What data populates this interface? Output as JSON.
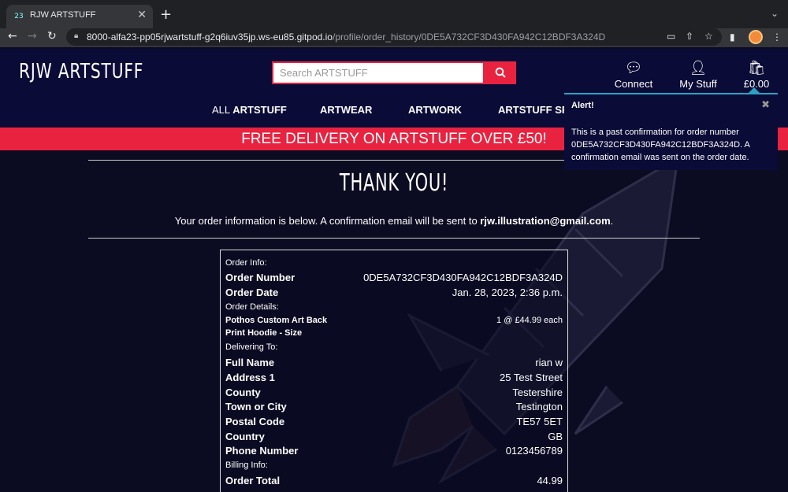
{
  "browser": {
    "tab_title": "RJW ARTSTUFF",
    "tab_favicon": "23",
    "url_host": "8000-alfa23-pp05rjwartstuff-g2q6iuv35jp.ws-eu85.gitpod.io",
    "url_path": "/profile/order_history/0DE5A732CF3D430FA942C12BDF3A324D",
    "icons": [
      "back-icon",
      "forward-icon",
      "reload-icon",
      "lock-icon",
      "card-icon",
      "share-icon",
      "star-icon",
      "sidebar-icon",
      "profile-avatar",
      "menu-icon"
    ]
  },
  "header": {
    "logo": "RJW ARTSTUFF",
    "search_placeholder": "Search ARTSTUFF",
    "connect_label": "Connect",
    "mystuff_label": "My Stuff",
    "bag_total": "£0.00",
    "nav": {
      "all_prefix": "ALL ",
      "all_main": "ARTSTUFF",
      "artwear": "ARTWEAR",
      "artwork": "ARTWORK",
      "artstuff_sp": "ARTSTUFF SP"
    },
    "accent_color": "#e8223f"
  },
  "banner": "FREE DELIVERY ON ARTSTUFF OVER £50!",
  "main": {
    "heading": "THANK YOU!",
    "info_prefix": "Your order information is below. A confirmation email will be sent to ",
    "email": "rjw.illustration@gmail.com",
    "info_suffix": "."
  },
  "order": {
    "order_info_heading": "Order Info:",
    "order_number_label": "Order Number",
    "order_number": "0DE5A732CF3D430FA942C12BDF3A324D",
    "order_date_label": "Order Date",
    "order_date": "Jan. 28, 2023, 2:36 p.m.",
    "order_details_heading": "Order Details:",
    "item_name_line1": "Pothos Custom Art Back",
    "item_name_line2": "Print Hoodie - Size",
    "item_qty_price": "1 @ £44.99 each",
    "delivering_heading": "Delivering To:",
    "full_name_label": "Full Name",
    "full_name": "rian w",
    "address1_label": "Address 1",
    "address1": "25 Test Street",
    "county_label": "County",
    "county": "Testershire",
    "town_label": "Town or City",
    "town": "Testington",
    "postal_label": "Postal Code",
    "postal": "TE57 5ET",
    "country_label": "Country",
    "country": "GB",
    "phone_label": "Phone Number",
    "phone": "0123456789",
    "billing_heading": "Billing Info:",
    "total_label": "Order Total",
    "total": "44.99"
  },
  "alert": {
    "title": "Alert!",
    "close": "✖",
    "body": "This is a past confirmation for order number 0DE5A732CF3D430FA942C12BDF3A324D. A confirmation email was sent on the order date.",
    "accent_color": "#2aa3c4"
  }
}
